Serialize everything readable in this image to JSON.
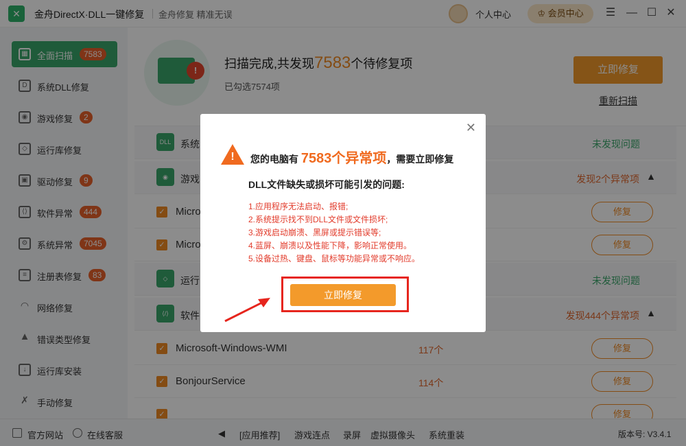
{
  "titlebar": {
    "app_title": "金舟DirectX·DLL一键修复",
    "slogan": "金舟修复 精准无误",
    "user_center": "个人中心",
    "vip": "会员中心",
    "menu_icon": "menu-icon",
    "minimize_icon": "minimize-icon",
    "maximize_icon": "maximize-icon",
    "close_icon": "close-icon"
  },
  "sidebar": {
    "items": [
      {
        "label": "全面扫描",
        "badge": "7583",
        "icon": "scan-icon",
        "active": true
      },
      {
        "label": "系统DLL修复",
        "badge": "",
        "icon": "dll-icon"
      },
      {
        "label": "游戏修复",
        "badge": "2",
        "icon": "gamepad-icon"
      },
      {
        "label": "运行库修复",
        "badge": "",
        "icon": "runtime-icon"
      },
      {
        "label": "驱动修复",
        "badge": "9",
        "icon": "driver-icon"
      },
      {
        "label": "软件异常",
        "badge": "444",
        "icon": "software-icon"
      },
      {
        "label": "系统异常",
        "badge": "7045",
        "icon": "system-gear-icon"
      },
      {
        "label": "注册表修复",
        "badge": "83",
        "icon": "registry-icon"
      },
      {
        "label": "网络修复",
        "badge": "",
        "icon": "wifi-icon"
      },
      {
        "label": "错误类型修复",
        "badge": "",
        "icon": "warning-icon"
      },
      {
        "label": "运行库安装",
        "badge": "",
        "icon": "install-icon"
      },
      {
        "label": "手动修复",
        "badge": "",
        "icon": "wrench-icon"
      }
    ]
  },
  "scan": {
    "title_prefix": "扫描完成,共发现",
    "count": "7583",
    "title_suffix": "个待修复项",
    "selected": "已勾选7574项",
    "fix_now": "立即修复",
    "rescan": "重新扫描"
  },
  "list": {
    "categories": [
      {
        "label": "系统",
        "status": "未发现问题",
        "icon_text": "DLL"
      },
      {
        "label": "游戏",
        "status": "发现2个异常项"
      },
      {
        "label": "运行",
        "status": "未发现问题"
      },
      {
        "label": "软件",
        "status": "发现444个异常项"
      }
    ],
    "items": [
      {
        "name": "Micro",
        "count": "",
        "fix": "修复"
      },
      {
        "name": "Micro",
        "count": "",
        "fix": "修复"
      },
      {
        "name": "Microsoft-Windows-WMI",
        "count": "117个",
        "fix": "修复"
      },
      {
        "name": "BonjourService",
        "count": "114个",
        "fix": "修复"
      },
      {
        "name": "",
        "count": "",
        "fix": "修复"
      }
    ]
  },
  "footer": {
    "website": "官方网站",
    "support": "在线客服",
    "recommend": "[应用推荐]",
    "links": [
      "游戏连点",
      "录屏",
      "虚拟摄像头",
      "系统重装"
    ],
    "version": "版本号: V3.4.1"
  },
  "modal": {
    "head_prefix": "您的电脑有",
    "head_count": "7583个异常项",
    "head_suffix": "，需要立即修复",
    "subtitle": "DLL文件缺失或损坏可能引发的问题:",
    "issues": [
      "1.应用程序无法启动、报错;",
      "2.系统提示找不到DLL文件或文件损坏;",
      "3.游戏启动崩溃、黑屏或提示错误等;",
      "4.蓝屏、崩溃以及性能下降，影响正常使用。",
      "5.设备过热、键盘、鼠标等功能异常或不响应。"
    ],
    "cta": "立即修复"
  },
  "colors": {
    "accent_green": "#3aa66a",
    "accent_orange": "#f39a2b",
    "danger_red": "#e23b2b"
  }
}
